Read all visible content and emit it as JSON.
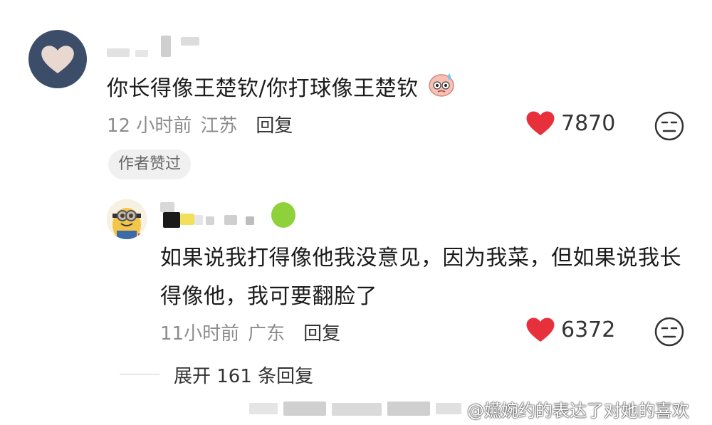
{
  "main_comment": {
    "text": "你长得像王楚钦/你打球像王楚钦",
    "time": "12 小时前",
    "location": "江苏",
    "reply_label": "回复",
    "likes": "7870",
    "author_badge": "作者赞过",
    "emoji_icon": "sweat-emoji-icon"
  },
  "reply_comment": {
    "text": "如果说我打得像他我没意见，因为我菜，但如果说我长得像他，我可要翻脸了",
    "time": "11小时前",
    "location": "广东",
    "reply_label": "回复",
    "likes": "6372"
  },
  "expand": {
    "label": "展开 161 条回复"
  },
  "watermark": {
    "text": "@嬿婉约的表达了对她的喜欢"
  },
  "colors": {
    "heart": "#e8303d",
    "meta_gray": "#8c8c8c",
    "avatar_bg": "#3c4d6a"
  }
}
